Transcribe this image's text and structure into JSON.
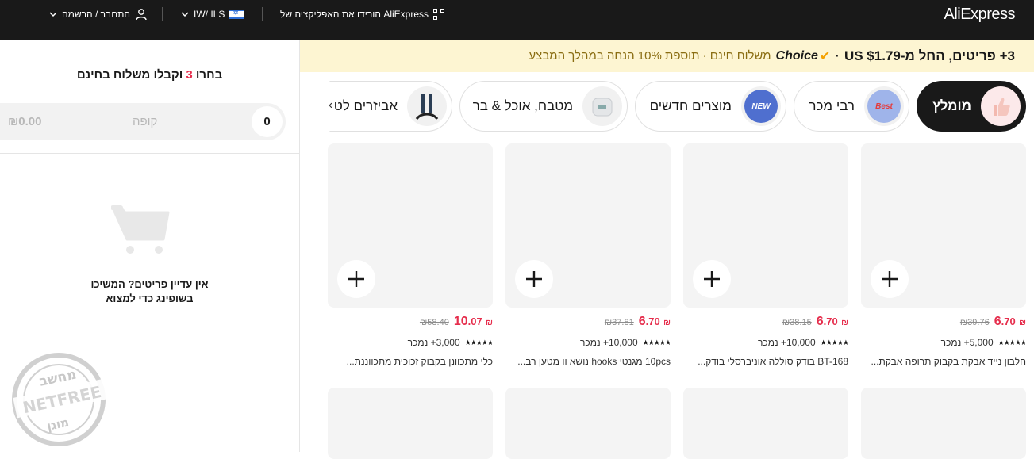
{
  "header": {
    "logo": "AliExpress",
    "app_download": "הורידו את האפליקציה של AliExpress",
    "locale": "IW/ ILS",
    "account": "התחבר / הרשמה"
  },
  "banner": {
    "main": "3+ פריטים, החל מ-US $1.79",
    "dot1": "·",
    "choice": "Choice",
    "sub": "משלוח חינם · תוספת 10% הנחה במהלך המבצע"
  },
  "tabs": [
    {
      "label": "מומלץ",
      "icon": "thumbs-up-icon",
      "active": true
    },
    {
      "label": "רבי מכר",
      "icon": "best-badge-icon",
      "badge": "Best"
    },
    {
      "label": "מוצרים חדשים",
      "icon": "new-badge-icon",
      "badge": "NEW"
    },
    {
      "label": "מטבח, אוכל & בר",
      "icon": "kitchen-scale-icon"
    },
    {
      "label": "אביזרים לט",
      "icon": "cable-icon"
    }
  ],
  "cart_panel": {
    "title_prefix": "בחרו",
    "title_num": "3",
    "title_suffix": "וקבלו משלוח בחינם",
    "count": "0",
    "checkout_label": "קופה",
    "total": "₪0.00",
    "empty_line1": "אין עדיין פריטים? המשיכו",
    "empty_line2": "בשופינג כדי למצוא"
  },
  "products": [
    {
      "price_cur": "₪",
      "price_int": "6",
      "price_frac": ".70",
      "old_price": "₪39.76",
      "sold": "5,000+ נמכר",
      "title": "חלבון נייד אבקת בקבוק תרופה אבקת..."
    },
    {
      "price_cur": "₪",
      "price_int": "6",
      "price_frac": ".70",
      "old_price": "₪38.15",
      "sold": "10,000+ נמכר",
      "title": "BT-168 בודק סוללה אוניברסלי בודק..."
    },
    {
      "price_cur": "₪",
      "price_int": "6",
      "price_frac": ".70",
      "old_price": "₪37.81",
      "sold": "10,000+ נמכר",
      "title": "10pcs מגנטי hooks נושא וו מטען רב..."
    },
    {
      "price_cur": "₪",
      "price_int": "10",
      "price_frac": ".07",
      "old_price": "₪58.40",
      "sold": "3,000+ נמכר",
      "title": "כלי מתכוונן בקבוק זכוכית מתכווננת..."
    }
  ],
  "watermark": {
    "top": "מחשב",
    "mid": "NETFREE",
    "bottom": "מוגן"
  },
  "colors": {
    "accent": "#e62e4d",
    "topbar": "#191919",
    "banner": "#fdf5d2"
  }
}
